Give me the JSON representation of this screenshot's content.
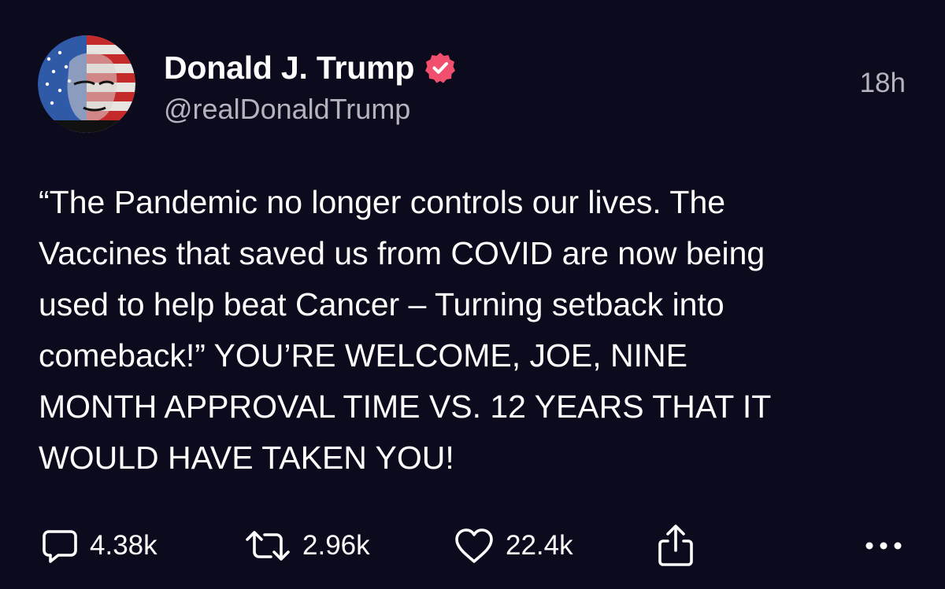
{
  "post": {
    "author": {
      "display_name": "Donald J. Trump",
      "handle": "@realDonaldTrump",
      "verified": true
    },
    "timestamp": "18h",
    "text": "“The Pandemic no longer controls our lives. The\nVaccines that saved us from COVID are now being\nused to help beat Cancer – Turning setback into\ncomeback!” YOU’RE WELCOME, JOE, NINE\nMONTH APPROVAL TIME VS. 12 YEARS THAT IT\nWOULD HAVE TAKEN YOU!",
    "actions": {
      "reply": {
        "icon": "speech-bubble-icon",
        "count": "4.38k"
      },
      "repost": {
        "icon": "repost-arrows-icon",
        "count": "2.96k"
      },
      "like": {
        "icon": "heart-icon",
        "count": "22.4k"
      },
      "share": {
        "icon": "share-upload-icon"
      },
      "more": {
        "icon": "ellipsis-icon"
      }
    }
  },
  "colors": {
    "background": "#0c0a1d",
    "text_primary": "#ffffff",
    "text_secondary": "#b5b3bd",
    "verified_badge": "#f0506e"
  }
}
